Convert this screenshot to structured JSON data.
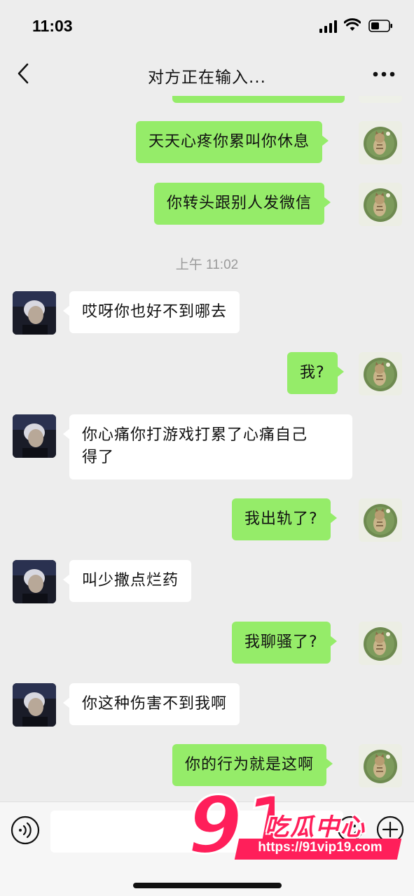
{
  "status_bar": {
    "time": "11:03",
    "icons": [
      "signal-icon",
      "wifi-icon",
      "battery-icon"
    ]
  },
  "nav": {
    "title": "对方正在输入...",
    "back_icon": "chevron-left-icon",
    "more_icon": "ellipsis-icon"
  },
  "chat": {
    "messages": [
      {
        "from": "me",
        "text": "天天心疼你累叫你休息"
      },
      {
        "from": "me",
        "text": "你转头跟别人发微信"
      },
      {
        "timestamp": "上午 11:02"
      },
      {
        "from": "other",
        "text": "哎呀你也好不到哪去"
      },
      {
        "from": "me",
        "text": "我?"
      },
      {
        "from": "other",
        "text_line1": "你心痛你打游戏打累了心痛自己",
        "text_line2": "得了"
      },
      {
        "from": "me",
        "text": "我出轨了?"
      },
      {
        "from": "other",
        "text": "叫少撒点烂药"
      },
      {
        "from": "me",
        "text": "我聊骚了?"
      },
      {
        "from": "other",
        "text": "你这种伤害不到我啊"
      },
      {
        "from": "me",
        "text": "你的行为就是这啊"
      }
    ]
  },
  "input_bar": {
    "message_value": "",
    "icons": [
      "voice-icon",
      "emoji-icon",
      "add-icon"
    ]
  },
  "watermark": {
    "number": "91",
    "brand": "吃瓜中心",
    "url": "https://91vip19.com"
  },
  "colors": {
    "background": "#ededed",
    "my_bubble": "#95ec69",
    "other_bubble": "#ffffff",
    "timestamp": "#9a9a9a",
    "watermark": "#ff1f5a"
  }
}
